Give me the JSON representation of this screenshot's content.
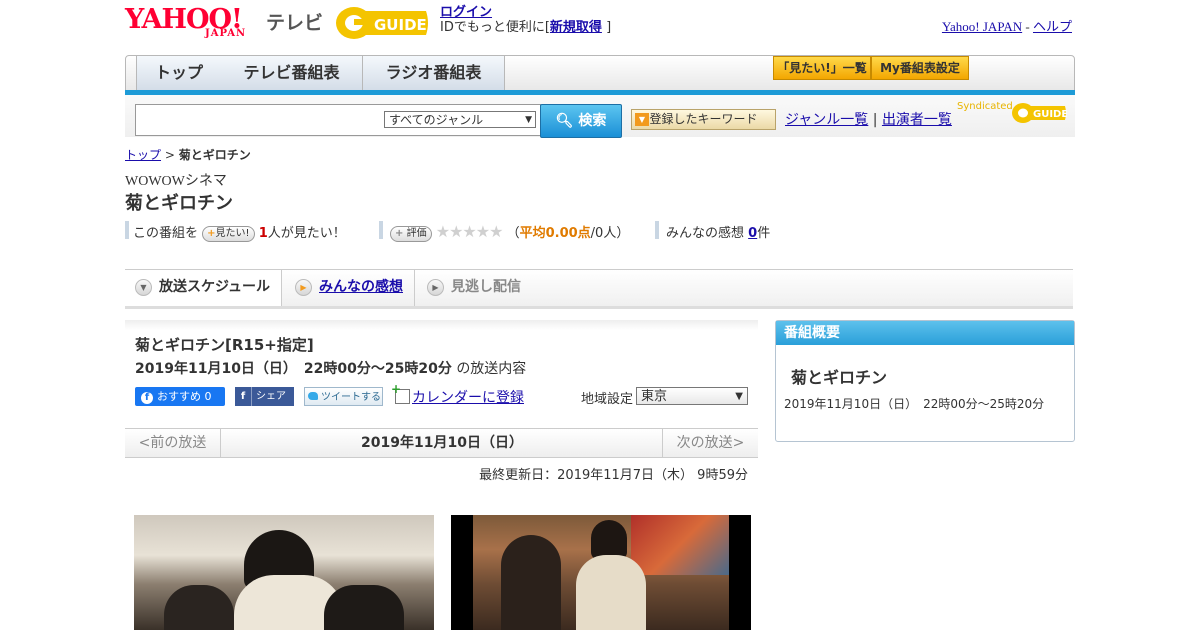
{
  "header": {
    "yahoo_logo": "YAHOO!",
    "japan_logo": "JAPAN",
    "tv_logo": "テレビ",
    "gguide_logo": "G-GUIDE",
    "login_label": "ログイン",
    "login_prompt_prefix": "IDでもっと便利に[",
    "signup_label": "新規取得",
    "login_prompt_suffix": "]",
    "yahoo_japan_link": "Yahoo! JAPAN",
    "separator": "-",
    "help_link": "ヘルプ"
  },
  "nav": {
    "tabs": [
      {
        "label": "トップ"
      },
      {
        "label": "テレビ番組表"
      },
      {
        "label": "ラジオ番組表"
      }
    ],
    "mitai_list_label": "「見たい!」一覧",
    "my_bangumi_label": "My番組表設定"
  },
  "search": {
    "genre_selected": "すべてのジャンル",
    "button_label": "検索",
    "keyword_button": "登録したキーワード",
    "genre_list_link": "ジャンル一覧",
    "divider": "|",
    "cast_list_link": "出演者一覧",
    "syndicated_label": "Syndicated"
  },
  "breadcrumb": {
    "top": "トップ",
    "sep": ">",
    "current": "菊とギロチン"
  },
  "program": {
    "channel": "WOWOWシネマ",
    "title": "菊とギロチン",
    "this_program": "この番組を",
    "mitai_button": "見たい!",
    "mitai_count": "1",
    "mitai_suffix": "人が見たい！",
    "rate_button": "評価",
    "stars": "★★★★★",
    "avg_prefix": "（",
    "avg_value": "平均0.00点",
    "avg_suffix": "/0人）",
    "kansou_label": "みんなの感想",
    "kansou_count": "0",
    "kansou_suffix": "件"
  },
  "tabs": {
    "schedule": "放送スケジュール",
    "reviews": "みんなの感想",
    "vod": "見逃し配信"
  },
  "broadcast": {
    "title": "菊とギロチン[R15+指定]",
    "datetime": "2019年11月10日（日）　22時00分～25時20分",
    "datetime_suffix": "の放送内容",
    "fb_recommend": "おすすめ 0",
    "fb_share": "シェア",
    "tweet": "ツイートする",
    "calendar": "カレンダーに登録",
    "region_label": "地域設定",
    "region_value": "東京",
    "prev": "<前の放送",
    "current_date": "2019年11月10日（日）",
    "next": "次の放送>",
    "updated": "最終更新日：2019年11月7日（木） 9時59分"
  },
  "summary": {
    "header": "番組概要",
    "title": "菊とギロチン",
    "datetime": "2019年11月10日（日）　22時00分～25時20分"
  }
}
